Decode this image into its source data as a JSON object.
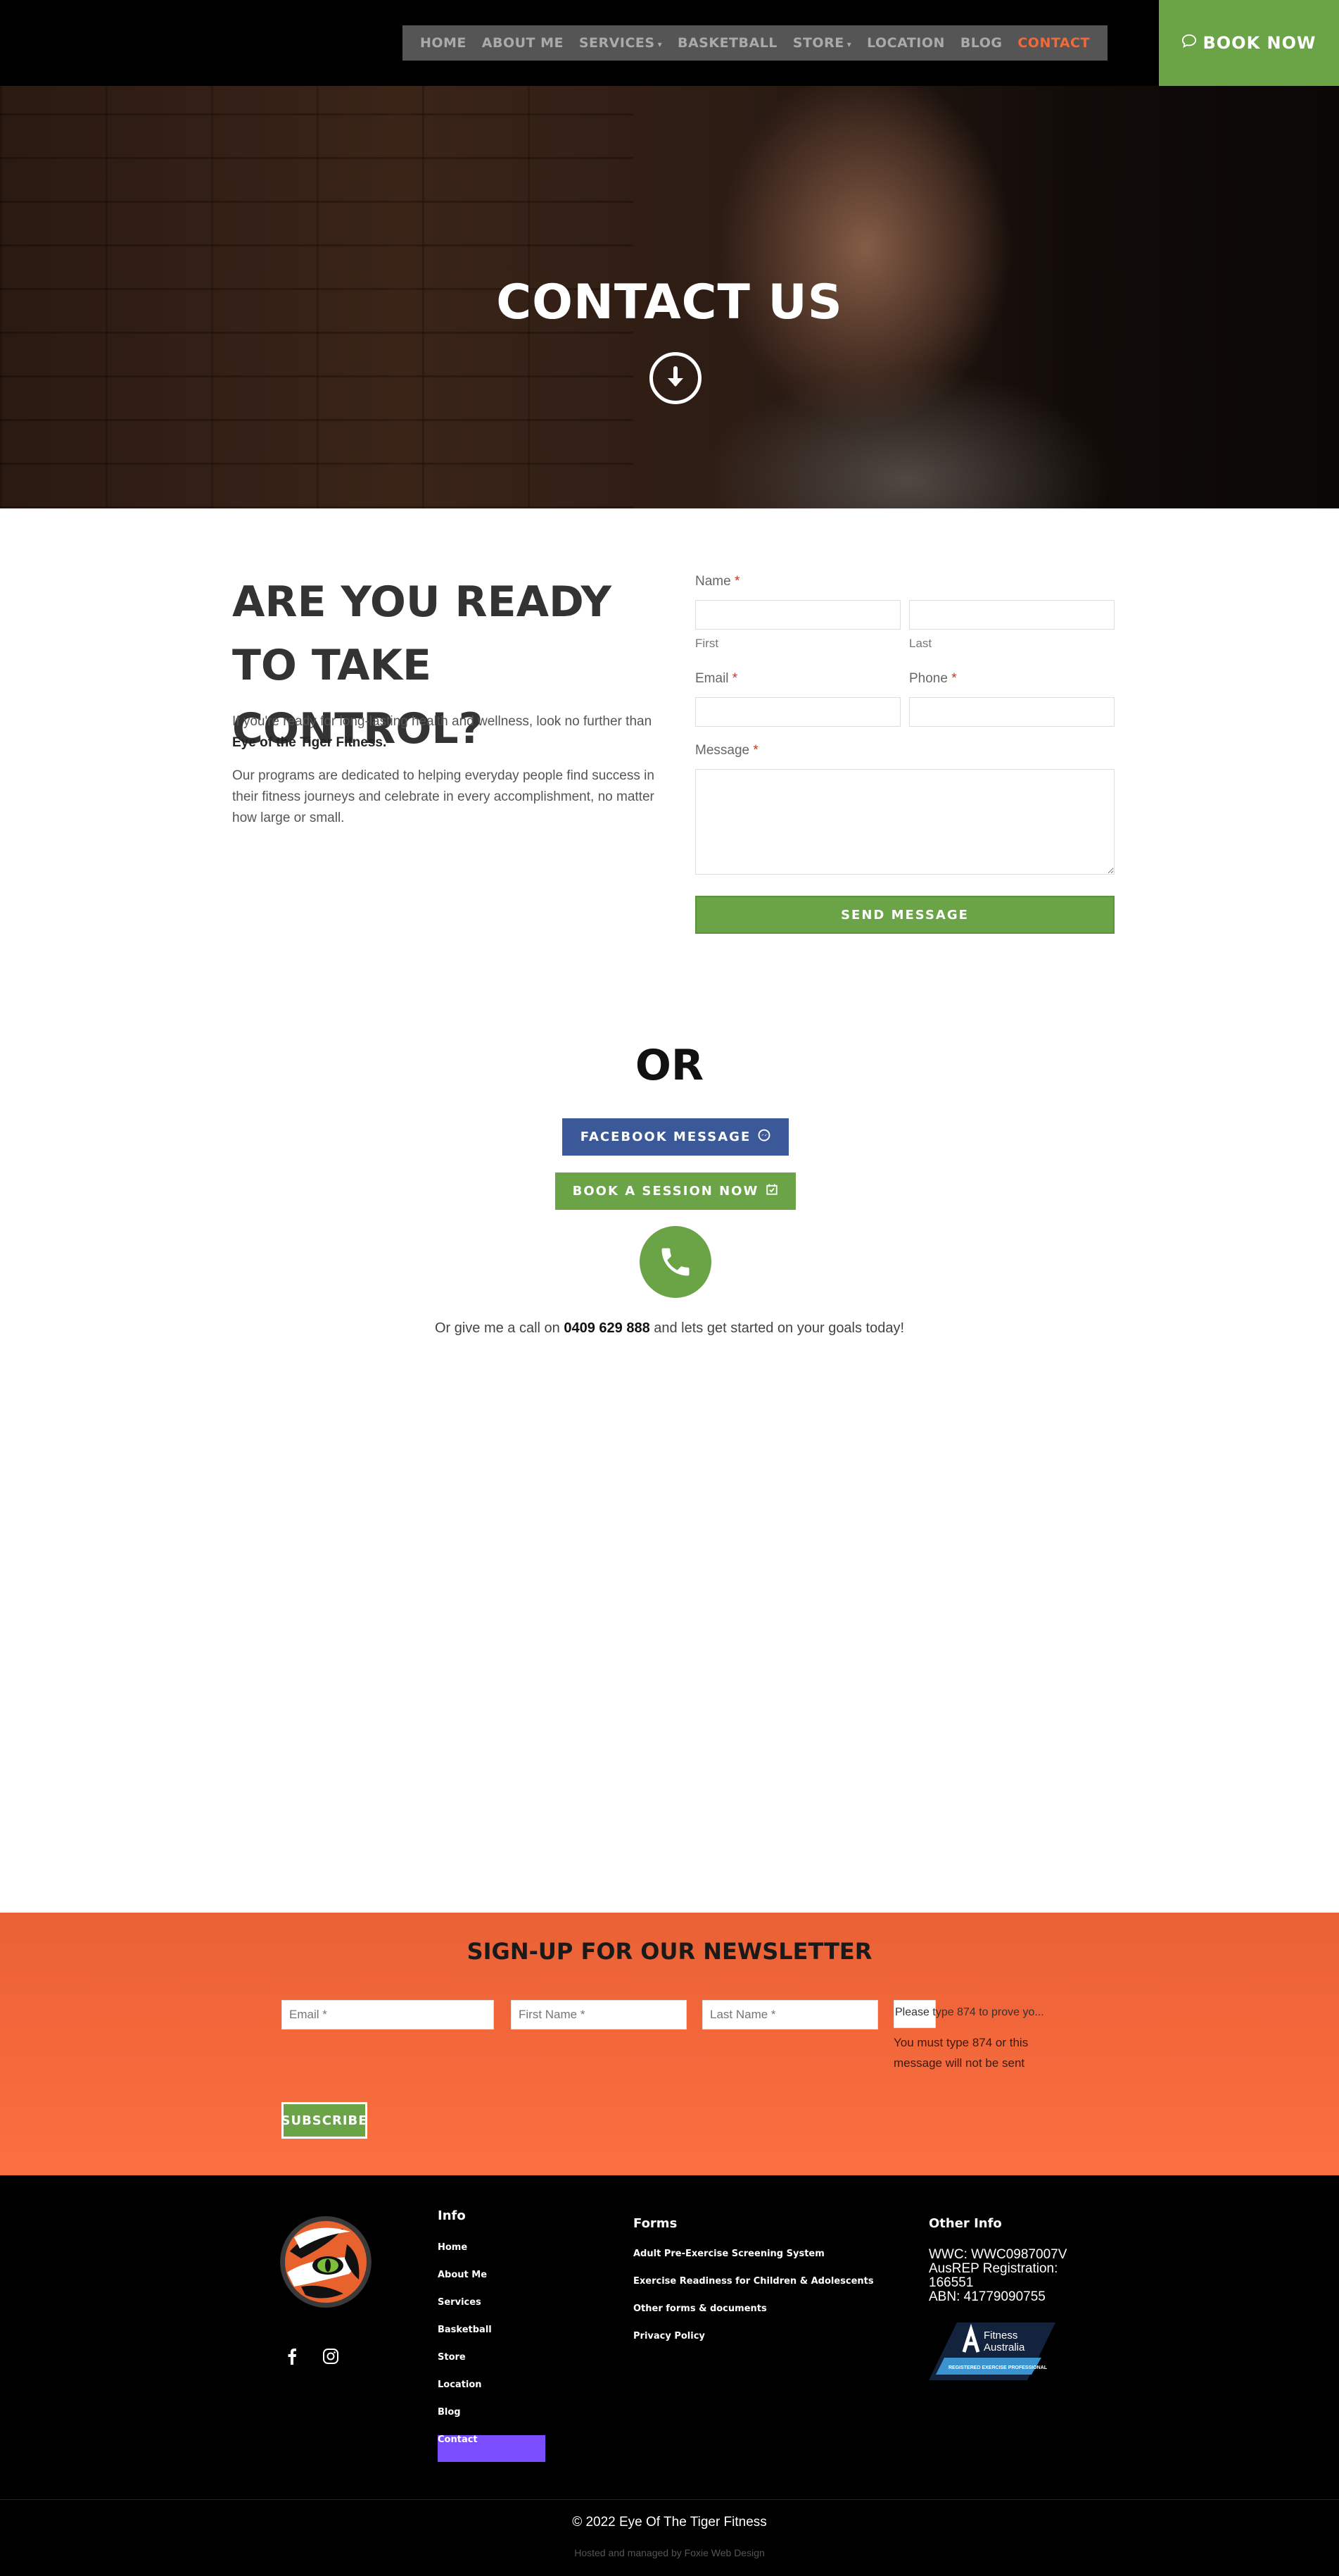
{
  "nav": {
    "items": [
      {
        "label": "HOME"
      },
      {
        "label": "ABOUT ME"
      },
      {
        "label": "SERVICES",
        "has_dropdown": true
      },
      {
        "label": "BASKETBALL"
      },
      {
        "label": "STORE",
        "has_dropdown": true
      },
      {
        "label": "LOCATION"
      },
      {
        "label": "BLOG"
      },
      {
        "label": "CONTACT",
        "active": true
      }
    ],
    "book_now": "BOOK NOW",
    "book_now_icon": "chat-bubble-icon"
  },
  "hero": {
    "title": "CONTACT US",
    "arrow_icon": "arrow-down-circle-icon"
  },
  "intro": {
    "heading": "ARE YOU READY TO TAKE CONTROL?",
    "p1_text": "If you're ready for long-lasting health and wellness, look no further than ",
    "p1_bold": "Eye of the Tiger Fitness.",
    "p2": "Our programs are dedicated to helping everyday people find success in their fitness journeys and celebrate in every accomplishment, no matter how large or small."
  },
  "form": {
    "name_label": "Name",
    "first_sublabel": "First",
    "last_sublabel": "Last",
    "email_label": "Email",
    "phone_label": "Phone",
    "message_label": "Message",
    "required_mark": "*",
    "first_value": "",
    "last_value": "",
    "email_value": "",
    "phone_value": "",
    "message_value": "",
    "send_label": "SEND MESSAGE"
  },
  "alt_contact": {
    "or": "OR",
    "facebook_label": "FACEBOOK MESSAGE",
    "facebook_icon": "messenger-icon",
    "session_label": "BOOK A SESSION NOW",
    "session_icon": "calendar-check-icon",
    "phone_icon": "phone-icon",
    "call_prefix": "Or give me a call on ",
    "call_number": "0409 629 888",
    "call_suffix": " and lets get started on your goals today!"
  },
  "newsletter": {
    "title": "SIGN-UP FOR OUR NEWSLETTER",
    "email_placeholder": "Email *",
    "first_placeholder": "First Name *",
    "last_placeholder": "Last Name *",
    "captcha_placeholder": "Please type 874 to prove yo...",
    "captcha_warning": "You must type 874 or this message will not be sent",
    "subscribe_label": "SUBSCRIBE"
  },
  "footer": {
    "info_heading": "Info",
    "info_links": [
      "Home",
      "About Me",
      "Services",
      "Basketball",
      "Store",
      "Location",
      "Blog",
      "Contact"
    ],
    "forms_heading": "Forms",
    "forms_links": [
      "Adult Pre-Exercise Screening System",
      "Exercise Readiness for Children & Adolescents",
      "Other forms & documents",
      "Privacy Policy"
    ],
    "other_heading": "Other Info",
    "other_lines": [
      "WWC: WWC0987007V",
      "AusREP Registration:",
      "166551",
      "ABN: 41779090755"
    ],
    "badge_line1": "Fitness",
    "badge_line2": "Australia",
    "badge_sub": "REGISTERED EXERCISE PROFESSIONAL",
    "social_icons": [
      "facebook-icon",
      "instagram-icon"
    ],
    "copyright": "© 2022 Eye Of The Tiger Fitness",
    "hosted": "Hosted and managed by Foxie Web Design"
  },
  "colors": {
    "green": "#6aa446",
    "orange": "#f16a3b",
    "facebook_blue": "#3b5998",
    "purple": "#7a4dff"
  }
}
